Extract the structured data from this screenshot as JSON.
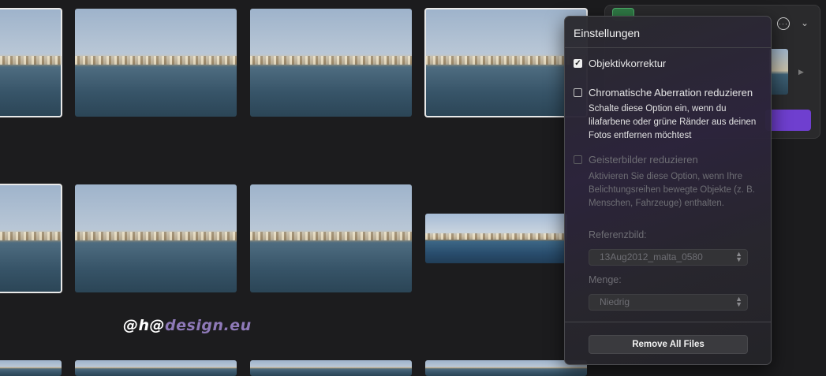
{
  "watermark": {
    "prefix": "@",
    "h": "h",
    "at": "@",
    "domain": "design.eu"
  },
  "settings": {
    "title": "Einstellungen",
    "lens_correction": {
      "label": "Objektivkorrektur",
      "checked": true
    },
    "chromatic_aberration": {
      "label": "Chromatische Aberration reduzieren",
      "checked": false,
      "description": "Schalte diese Option ein, wenn du lilafarbene oder grüne Ränder aus deinen Fotos entfernen möchtest"
    },
    "ghosting": {
      "label": "Geisterbilder reduzieren",
      "checked": false,
      "description": "Aktivieren Sie diese Option, wenn Ihre Belichtungsreihen bewegte Objekte (z. B. Menschen, Fahrzeuge) enthalten."
    },
    "reference_label": "Referenzbild:",
    "reference_value": "13Aug2012_malta_0580",
    "amount_label": "Menge:",
    "amount_value": "Niedrig",
    "remove_button": "Remove All Files"
  }
}
